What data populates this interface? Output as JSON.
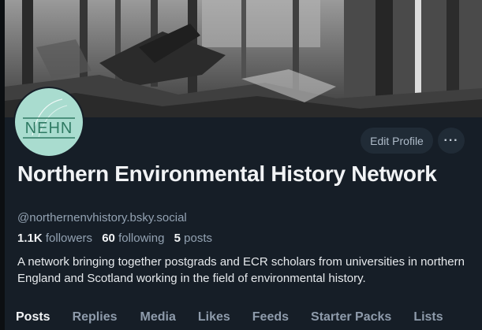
{
  "profile": {
    "display_name": "Northern Environmental History Network",
    "handle": "@northernenvhistory.bsky.social",
    "description": "A network bringing together postgrads and ECR scholars from universities in northern England and Scotland working in the field of environmental history.",
    "avatar_text": "NEHN"
  },
  "stats": {
    "followers_count": "1.1K",
    "followers_label": "followers",
    "following_count": "60",
    "following_label": "following",
    "posts_count": "5",
    "posts_label": "posts"
  },
  "actions": {
    "edit_label": "Edit Profile",
    "more_label": "···"
  },
  "tabs": [
    {
      "label": "Posts",
      "active": true
    },
    {
      "label": "Replies",
      "active": false
    },
    {
      "label": "Media",
      "active": false
    },
    {
      "label": "Likes",
      "active": false
    },
    {
      "label": "Feeds",
      "active": false
    },
    {
      "label": "Starter Packs",
      "active": false
    },
    {
      "label": "Lists",
      "active": false
    }
  ],
  "colors": {
    "background": "#161e27",
    "button_bg": "#202b36",
    "muted_text": "#93a2b2",
    "avatar_bg": "#a9dccf",
    "avatar_ink": "#2f7a63"
  }
}
